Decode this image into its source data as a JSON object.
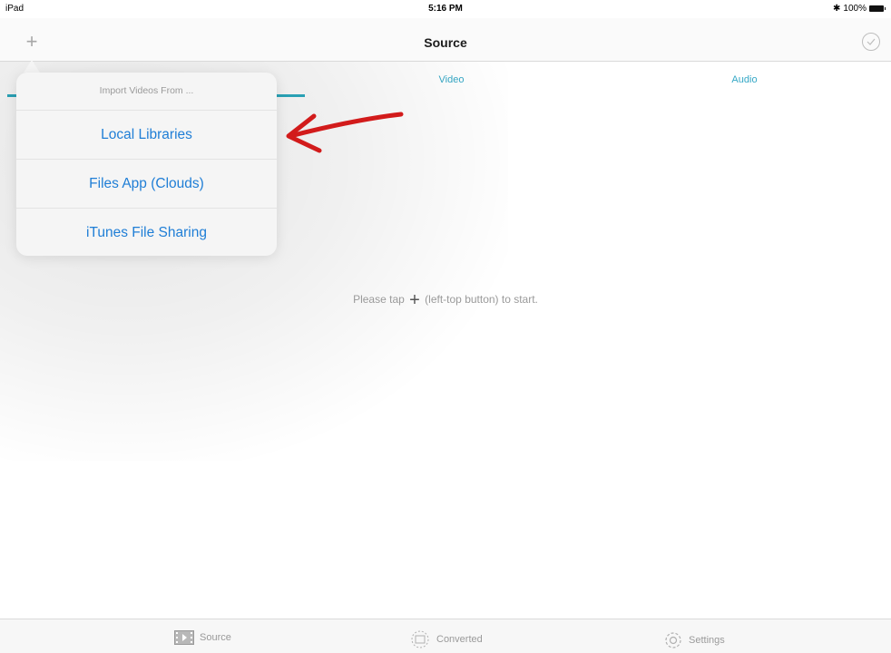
{
  "status_bar": {
    "carrier": "iPad",
    "time": "5:16 PM",
    "battery": "100%",
    "bluetooth_icon": "bluetooth-icon"
  },
  "nav": {
    "title": "Source",
    "add_icon": "+",
    "done_icon": "checkmark-circle-icon"
  },
  "tabs": [
    {
      "label": ""
    },
    {
      "label": "Video"
    },
    {
      "label": "Audio"
    }
  ],
  "popover": {
    "header": "Import Videos From ...",
    "items": [
      {
        "label": "Local Libraries"
      },
      {
        "label": "Files App (Clouds)"
      },
      {
        "label": "iTunes File Sharing"
      }
    ]
  },
  "hint": {
    "prefix": "Please tap",
    "plus": "+",
    "suffix": "(left-top button) to start."
  },
  "tab_bar": {
    "items": [
      {
        "label": "Source",
        "icon": "film-icon"
      },
      {
        "label": "Converted",
        "icon": "film-circle-icon"
      },
      {
        "label": "Settings",
        "icon": "gear-icon"
      }
    ]
  },
  "colors": {
    "accent": "#2cabc0",
    "link": "#1f7ed6",
    "annotation": "#d21b1b"
  }
}
